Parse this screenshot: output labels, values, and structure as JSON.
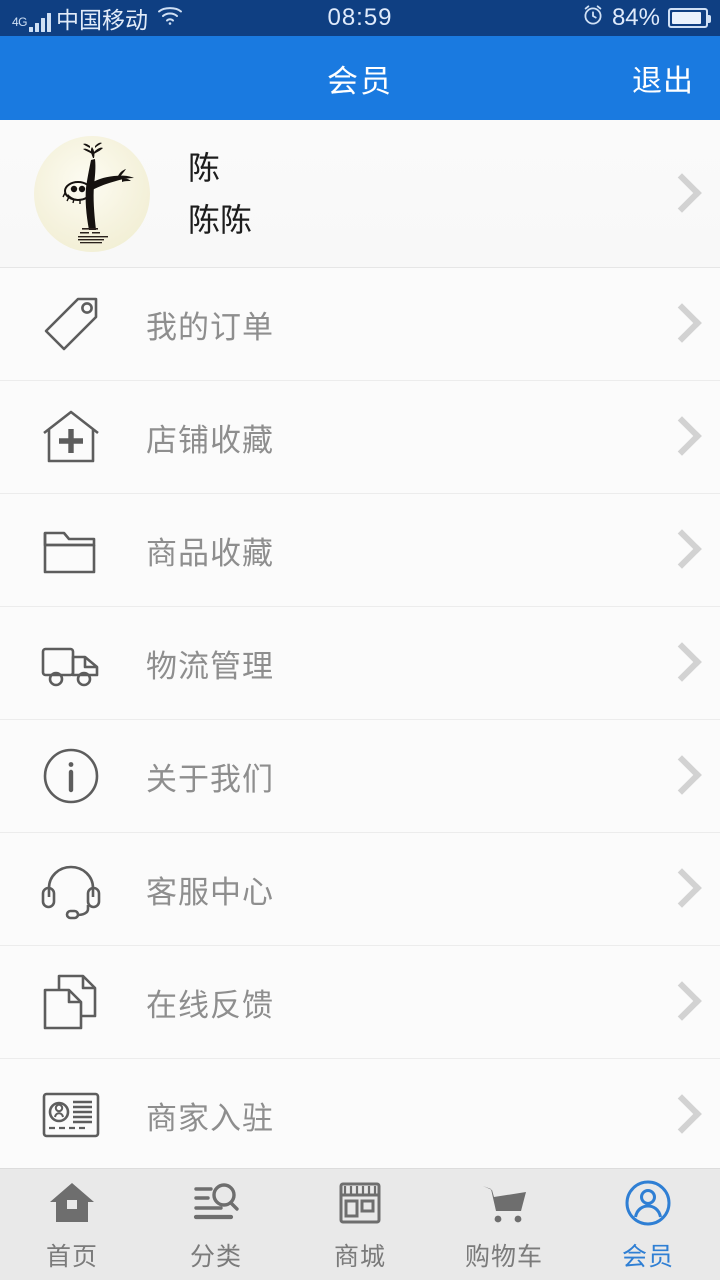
{
  "status_bar": {
    "network_type": "4G",
    "carrier": "中国移动",
    "wifi_icon": "wifi-icon",
    "time": "08:59",
    "alarm_icon": "alarm-clock-icon",
    "battery_percent": "84%",
    "battery_level": 84
  },
  "header": {
    "title": "会员",
    "action_label": "退出",
    "background_color": "#1a7ae0"
  },
  "profile": {
    "avatar_name": "user-avatar",
    "avatar_description": "ink-painting-tree",
    "name": "陈",
    "nickname": "陈陈",
    "chevron": "chevron-right-icon"
  },
  "menu": {
    "items": [
      {
        "label": "我的订单",
        "icon": "tag-icon"
      },
      {
        "label": "店铺收藏",
        "icon": "house-plus-icon"
      },
      {
        "label": "商品收藏",
        "icon": "folder-icon"
      },
      {
        "label": "物流管理",
        "icon": "truck-icon"
      },
      {
        "label": "关于我们",
        "icon": "info-circle-icon"
      },
      {
        "label": "客服中心",
        "icon": "headset-icon"
      },
      {
        "label": "在线反馈",
        "icon": "documents-icon"
      },
      {
        "label": "商家入驻",
        "icon": "id-card-icon"
      }
    ]
  },
  "tabbar": {
    "active_color": "#2f7fd4",
    "inactive_color": "#6e6e6e",
    "items": [
      {
        "label": "首页",
        "icon": "home-icon",
        "active": false
      },
      {
        "label": "分类",
        "icon": "category-search-icon",
        "active": false
      },
      {
        "label": "商城",
        "icon": "store-icon",
        "active": false
      },
      {
        "label": "购物车",
        "icon": "shopping-cart-icon",
        "active": false
      },
      {
        "label": "会员",
        "icon": "user-circle-icon",
        "active": true
      }
    ]
  }
}
